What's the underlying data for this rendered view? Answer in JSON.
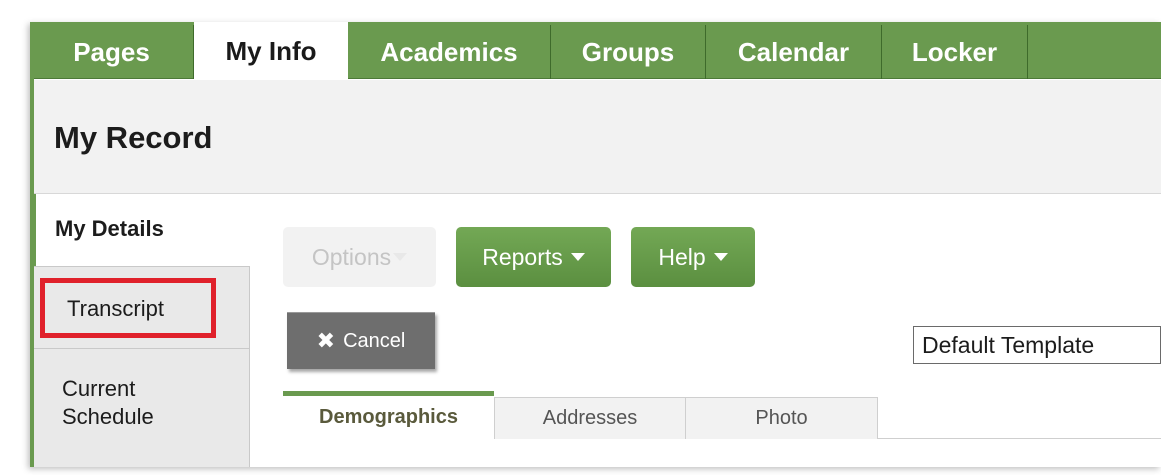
{
  "top_tabs": [
    {
      "label": "Pages",
      "active": false
    },
    {
      "label": "My Info",
      "active": true
    },
    {
      "label": "Academics",
      "active": false
    },
    {
      "label": "Groups",
      "active": false
    },
    {
      "label": "Calendar",
      "active": false
    },
    {
      "label": "Locker",
      "active": false
    }
  ],
  "header": {
    "title": "My Record"
  },
  "side_nav": {
    "items": [
      {
        "label": "My Details",
        "active": true
      },
      {
        "label": "Transcript",
        "highlighted": true
      },
      {
        "label": "Current Schedule"
      }
    ]
  },
  "toolbar": {
    "options_label": "Options",
    "reports_label": "Reports",
    "help_label": "Help",
    "cancel_label": "Cancel"
  },
  "template_select": {
    "value": "Default Template"
  },
  "sub_tabs": [
    {
      "label": "Demographics",
      "active": true
    },
    {
      "label": "Addresses"
    },
    {
      "label": "Photo"
    }
  ],
  "colors": {
    "accent_green": "#6a9a4f",
    "highlight_red": "#e0212b",
    "cancel_gray": "#6e6e6e"
  },
  "icons": {
    "cancel": "close-icon",
    "dropdown": "caret-down-icon"
  }
}
